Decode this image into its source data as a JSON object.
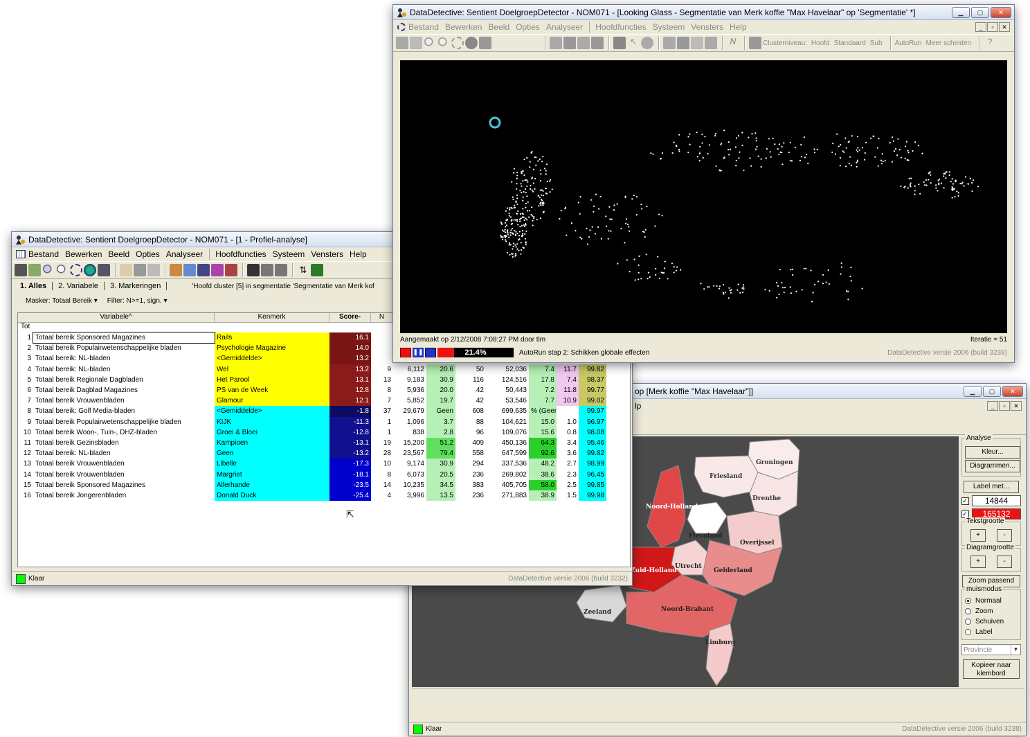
{
  "windows": {
    "main": {
      "title": "DataDetective:  Sentient DoelgroepDetector - NOM071 - [Looking Glass - Segmentatie van Merk koffie \"Max Havelaar\" op 'Segmentatie' *]",
      "menu": [
        "Bestand",
        "Bewerken",
        "Beeld",
        "Opties",
        "Analyseer",
        "Hoofdfuncties",
        "Systeem",
        "Vensters",
        "Help"
      ],
      "toolbar_text": {
        "level": "Clusterniveau:",
        "main": "Hoofd",
        "std": "Standaard",
        "sub": "Sub",
        "autorun": "AutoRun",
        "split": "Meer scheiden"
      },
      "created": "Aangemaakt op 2/12/2008 7:08:27 PM door tim",
      "iteration": "Iteratie = 51",
      "progress": "21.4%",
      "progress_value": 21.4,
      "autorun_step": "AutoRun stap 2: Schikken globale effecten",
      "version": "DataDetective versie 2006 (build 3238)"
    },
    "profile": {
      "title": "DataDetective:  Sentient DoelgroepDetector - NOM071 - [1 - Profiel-analyse]",
      "menu": [
        "Bestand",
        "Bewerken",
        "Beeld",
        "Opties",
        "Analyseer",
        "Hoofdfuncties",
        "Systeem",
        "Vensters",
        "Help"
      ],
      "tabs": [
        "1. Alles",
        "2. Variabele",
        "3. Markeringen"
      ],
      "cluster_text": "'Hoofd cluster [5] in segmentatie 'Segmentatie van Merk kof",
      "mask": "Masker: Totaal Bereik",
      "filter": "Filter: N>=1, sign.",
      "headers": {
        "variabele": "Variabele^",
        "kenmerk": "Kenmerk",
        "score": "Score-",
        "n": "N"
      },
      "tot_label": "Tot",
      "status": "Klaar",
      "version": "DataDetective versie 2006 (build 3232)"
    },
    "map": {
      "title_fragment": "op [Merk koffie \"Max Havelaar\"]]",
      "menu_fragment": "lp",
      "status": "Klaar",
      "version": "DataDetective versie 2006 (build 3238)",
      "panel": {
        "analyse": "Analyse",
        "kleur": "Kleur...",
        "diagrammen": "Diagrammen...",
        "label_met": "Label met...",
        "val1": "14844",
        "val2": "165132",
        "tekstgrootte": "Tekstgrootte",
        "diagramgrootte": "Diagramgrootte",
        "plus": "+",
        "minus": "-",
        "zoom_passend": "Zoom passend",
        "muismodus": "muismodus",
        "modes": [
          "Normaal",
          "Zoom",
          "Schuiven",
          "Label"
        ],
        "provincie": "Provincie",
        "kopieer": "Kopieer naar klembord"
      },
      "provinces": [
        "Groningen",
        "Friesland",
        "Drenthe",
        "Noord-Holland",
        "Flevoland",
        "Overijssel",
        "Utrecht",
        "Gelderland",
        "Zuid-Holland",
        "Zeeland",
        "Noord-Brabant",
        "Limburg"
      ]
    }
  },
  "rows": [
    {
      "i": "1",
      "var": "Totaal bereik Sponsored Magazines",
      "kenmerk": "Rails",
      "score": "16.1",
      "n": "",
      "a": "",
      "b": "",
      "c": "",
      "d": "",
      "e": "",
      "f": "",
      "g": ""
    },
    {
      "i": "2",
      "var": "Totaal bereik Populairwetenschappelijke bladen",
      "kenmerk": "Psychologie Magazine",
      "score": "14.0",
      "n": "",
      "a": "",
      "b": "",
      "c": "",
      "d": "",
      "e": "",
      "f": "",
      "g": ""
    },
    {
      "i": "3",
      "var": "Totaal bereik: NL-bladen",
      "kenmerk": "<Gemiddelde>",
      "score": "13.2",
      "n": "",
      "a": "",
      "b": "",
      "c": "",
      "d": "",
      "e": "",
      "f": "",
      "g": ""
    },
    {
      "i": "4",
      "var": "Totaal bereik: NL-bladen",
      "kenmerk": "Wel",
      "score": "13.2",
      "n": "9",
      "a": "6,112",
      "b": "20.6",
      "c": "50",
      "d": "52,036",
      "e": "7.4",
      "f": "11.7",
      "g": "99.82"
    },
    {
      "i": "5",
      "var": "Totaal bereik Regionale Dagbladen",
      "kenmerk": "Het Parool",
      "score": "13.1",
      "n": "13",
      "a": "9,183",
      "b": "30.9",
      "c": "116",
      "d": "124,516",
      "e": "17.8",
      "f": "7.4",
      "g": "98.37"
    },
    {
      "i": "6",
      "var": "Totaal bereik Dagblad Magazines",
      "kenmerk": "PS van de Week",
      "score": "12.8",
      "n": "8",
      "a": "5,936",
      "b": "20.0",
      "c": "42",
      "d": "50,443",
      "e": "7.2",
      "f": "11.8",
      "g": "99.77"
    },
    {
      "i": "7",
      "var": "Totaal bereik Vrouwenbladen",
      "kenmerk": "Glamour",
      "score": "12.1",
      "n": "7",
      "a": "5,852",
      "b": "19.7",
      "c": "42",
      "d": "53,546",
      "e": "7.7",
      "f": "10.9",
      "g": "99.02"
    },
    {
      "i": "8",
      "var": "Totaal bereik: Golf Media-bladen",
      "kenmerk": "<Gemiddelde>",
      "score": "-1.8",
      "n": "37",
      "a": "29,679",
      "b": "Geen",
      "c": "608",
      "d": "699,635",
      "e": "% (Geen)",
      "f": "",
      "g": "99.97"
    },
    {
      "i": "9",
      "var": "Totaal bereik Populairwetenschappelijke bladen",
      "kenmerk": "KIJK",
      "score": "-11.3",
      "n": "1",
      "a": "1,096",
      "b": "3.7",
      "c": "88",
      "d": "104,621",
      "e": "15.0",
      "f": "1.0",
      "g": "96.97"
    },
    {
      "i": "10",
      "var": "Totaal bereik Woon-, Tuin-, DHZ-bladen",
      "kenmerk": "Groei & Bloei",
      "score": "-12.8",
      "n": "1",
      "a": "838",
      "b": "2.8",
      "c": "96",
      "d": "109,076",
      "e": "15.6",
      "f": "0.8",
      "g": "98.08"
    },
    {
      "i": "11",
      "var": "Totaal bereik Gezinsbladen",
      "kenmerk": "Kampioen",
      "score": "-13.1",
      "n": "19",
      "a": "15,200",
      "b": "51.2",
      "c": "409",
      "d": "450,136",
      "e": "64.3",
      "f": "3.4",
      "g": "95.46"
    },
    {
      "i": "12",
      "var": "Totaal bereik: NL-bladen",
      "kenmerk": "Geen",
      "score": "-13.2",
      "n": "28",
      "a": "23,567",
      "b": "79.4",
      "c": "558",
      "d": "647,599",
      "e": "92.6",
      "f": "3.6",
      "g": "99.82"
    },
    {
      "i": "13",
      "var": "Totaal bereik Vrouwenbladen",
      "kenmerk": "Libelle",
      "score": "-17.3",
      "n": "10",
      "a": "9,174",
      "b": "30.9",
      "c": "294",
      "d": "337,536",
      "e": "48.2",
      "f": "2.7",
      "g": "98.99"
    },
    {
      "i": "14",
      "var": "Totaal bereik Vrouwenbladen",
      "kenmerk": "Margriet",
      "score": "-18.1",
      "n": "8",
      "a": "6,073",
      "b": "20.5",
      "c": "236",
      "d": "269,802",
      "e": "38.6",
      "f": "2.3",
      "g": "96.45"
    },
    {
      "i": "15",
      "var": "Totaal bereik Sponsored Magazines",
      "kenmerk": "Allerhande",
      "score": "-23.5",
      "n": "14",
      "a": "10,235",
      "b": "34.5",
      "c": "383",
      "d": "405,705",
      "e": "58.0",
      "f": "2.5",
      "g": "99.85"
    },
    {
      "i": "16",
      "var": "Totaal bereik Jongerenbladen",
      "kenmerk": "Donald Duck",
      "score": "-25.4",
      "n": "4",
      "a": "3,996",
      "b": "13.5",
      "c": "236",
      "d": "271,883",
      "e": "38.9",
      "f": "1.5",
      "g": "99.98"
    }
  ]
}
